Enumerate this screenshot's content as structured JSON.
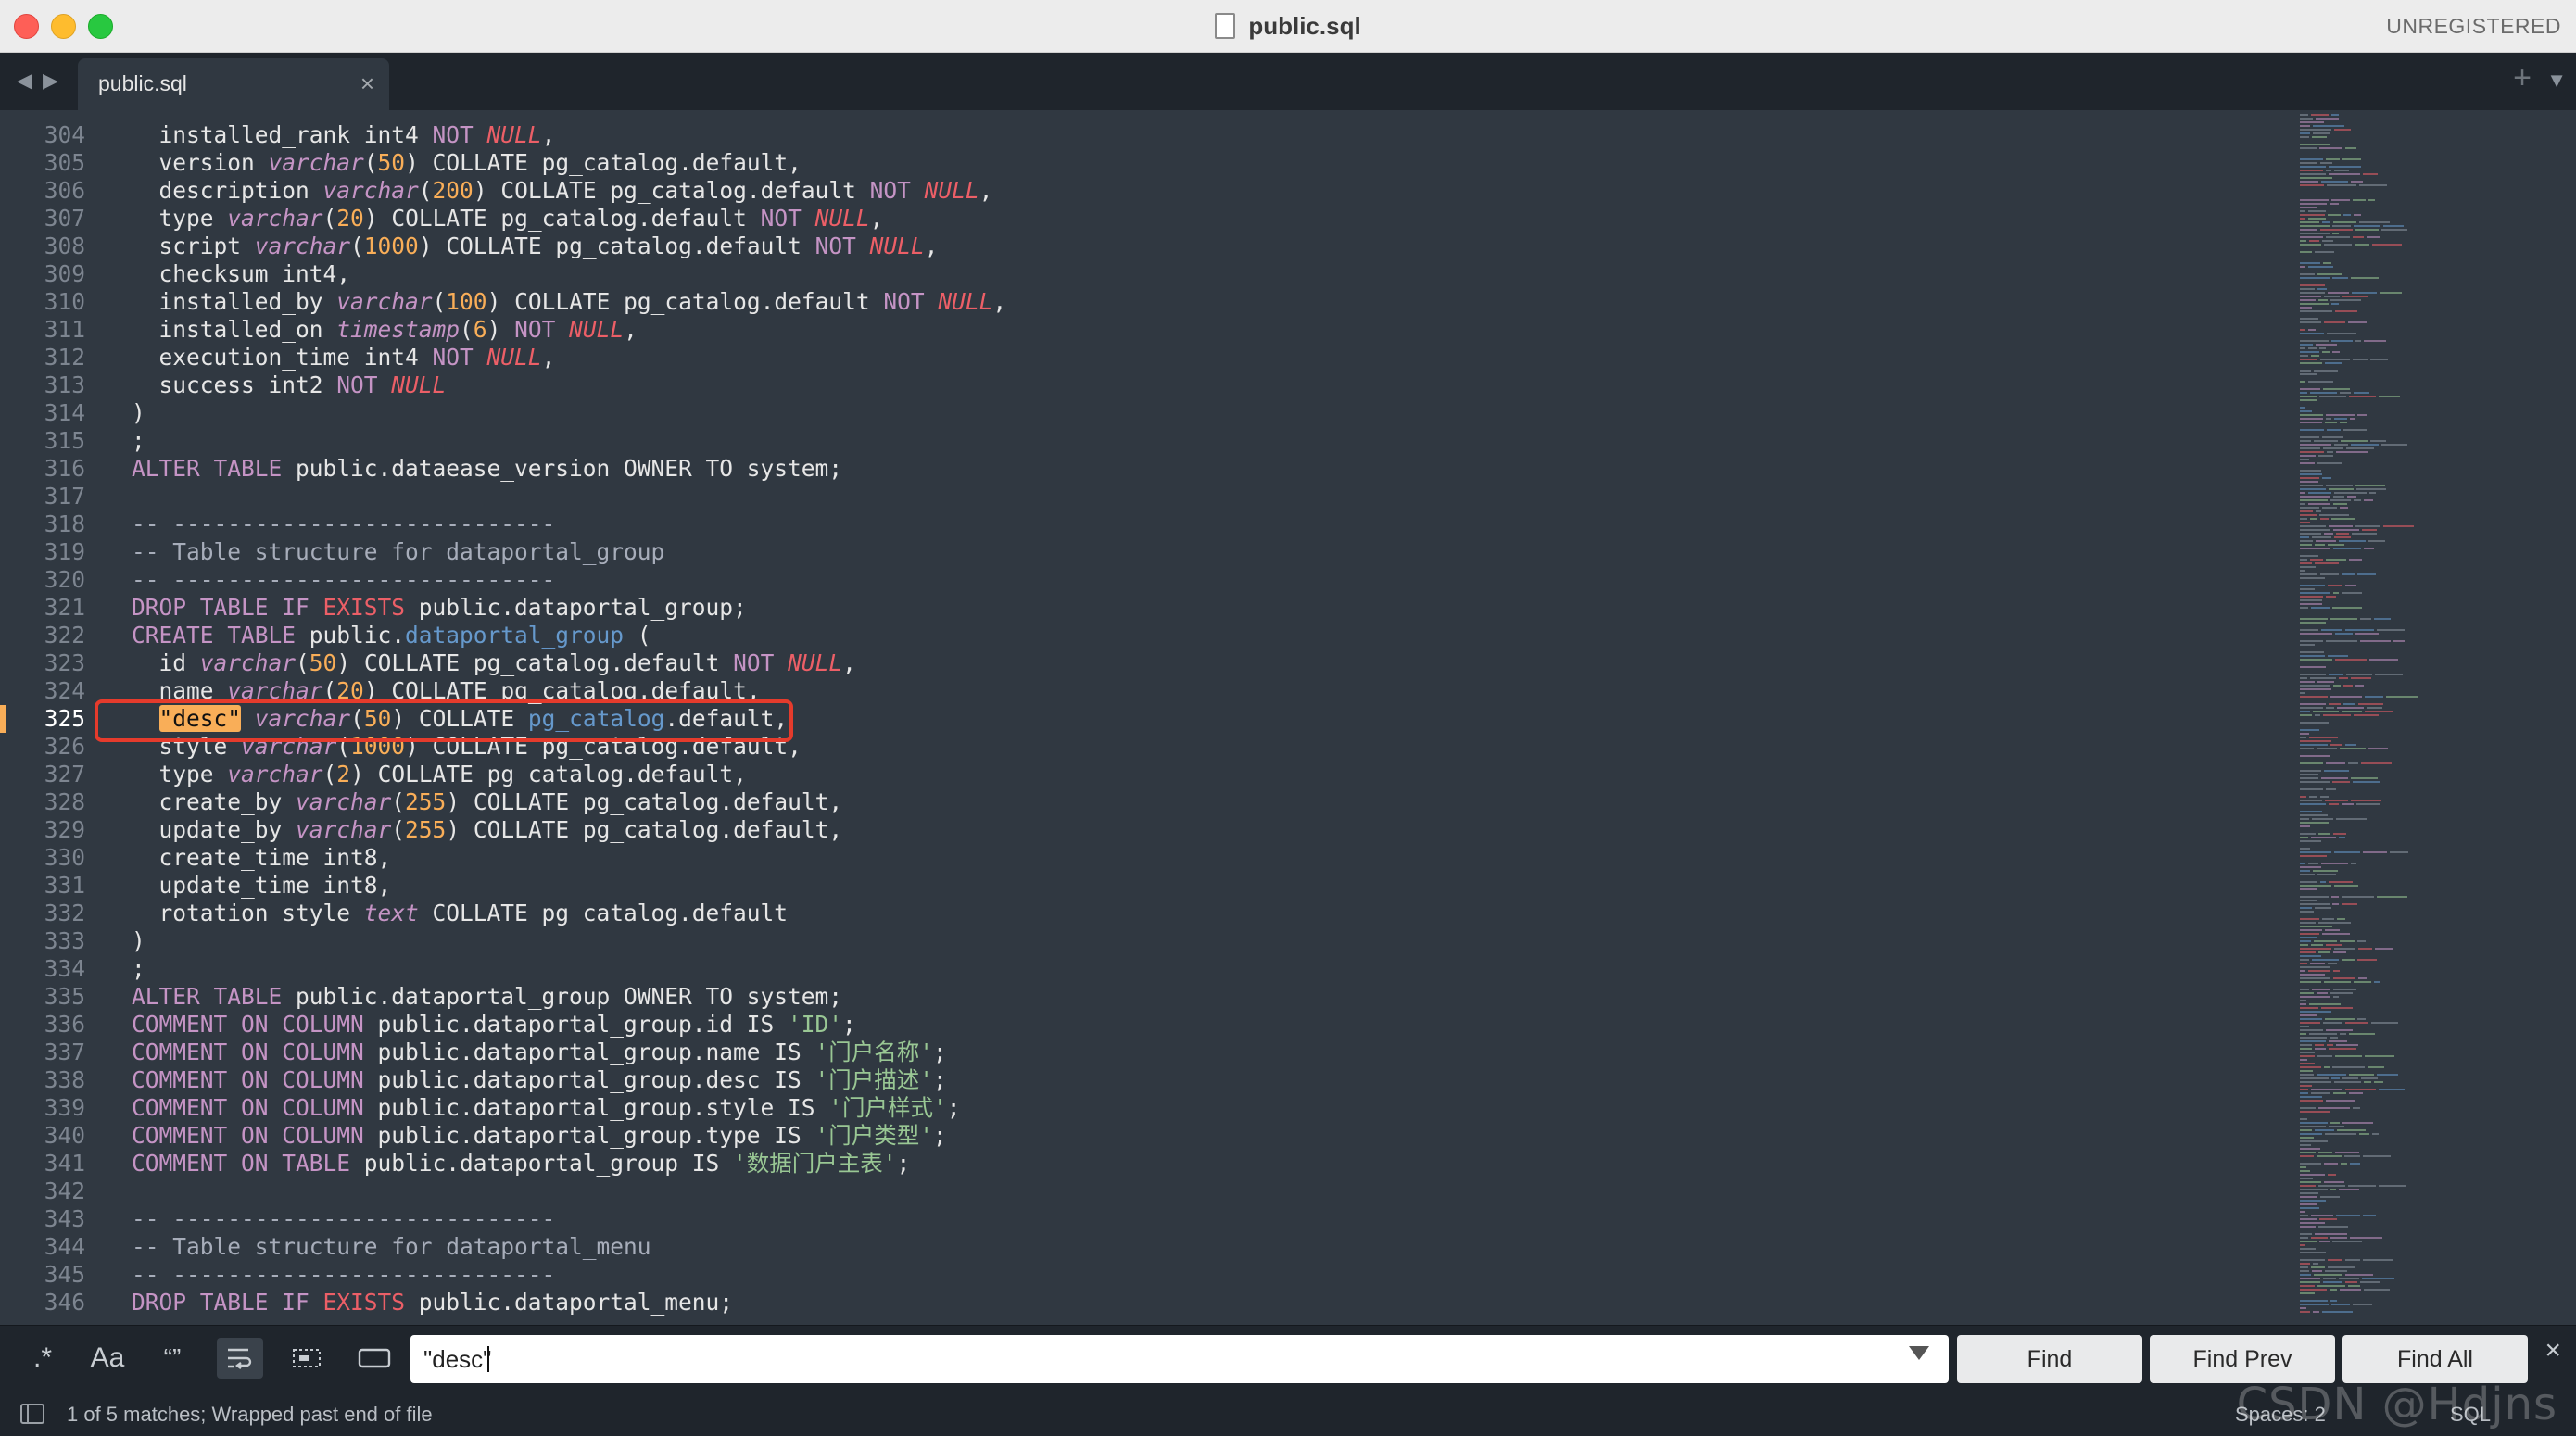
{
  "window": {
    "title": "public.sql",
    "registration": "UNREGISTERED"
  },
  "tabs": [
    {
      "label": "public.sql",
      "active": true
    }
  ],
  "editor": {
    "current_line": 325,
    "lines": [
      {
        "n": "304",
        "t": [
          [
            "  installed_rank int4 ",
            "plain"
          ],
          [
            "NOT",
            "kw"
          ],
          [
            " ",
            "plain"
          ],
          [
            "NULL",
            "redit"
          ],
          [
            ",",
            "plain"
          ]
        ]
      },
      {
        "n": "305",
        "t": [
          [
            "  version ",
            "plain"
          ],
          [
            "varchar",
            "type"
          ],
          [
            "(",
            "plain"
          ],
          [
            "50",
            "num"
          ],
          [
            ") COLLATE pg_catalog.default,",
            "plain"
          ]
        ]
      },
      {
        "n": "306",
        "t": [
          [
            "  description ",
            "plain"
          ],
          [
            "varchar",
            "type"
          ],
          [
            "(",
            "plain"
          ],
          [
            "200",
            "num"
          ],
          [
            ") COLLATE pg_catalog.default ",
            "plain"
          ],
          [
            "NOT",
            "kw"
          ],
          [
            " ",
            "plain"
          ],
          [
            "NULL",
            "redit"
          ],
          [
            ",",
            "plain"
          ]
        ]
      },
      {
        "n": "307",
        "t": [
          [
            "  type ",
            "plain"
          ],
          [
            "varchar",
            "type"
          ],
          [
            "(",
            "plain"
          ],
          [
            "20",
            "num"
          ],
          [
            ") COLLATE pg_catalog.default ",
            "plain"
          ],
          [
            "NOT",
            "kw"
          ],
          [
            " ",
            "plain"
          ],
          [
            "NULL",
            "redit"
          ],
          [
            ",",
            "plain"
          ]
        ]
      },
      {
        "n": "308",
        "t": [
          [
            "  script ",
            "plain"
          ],
          [
            "varchar",
            "type"
          ],
          [
            "(",
            "plain"
          ],
          [
            "1000",
            "num"
          ],
          [
            ") COLLATE pg_catalog.default ",
            "plain"
          ],
          [
            "NOT",
            "kw"
          ],
          [
            " ",
            "plain"
          ],
          [
            "NULL",
            "redit"
          ],
          [
            ",",
            "plain"
          ]
        ]
      },
      {
        "n": "309",
        "t": [
          [
            "  checksum int4,",
            "plain"
          ]
        ]
      },
      {
        "n": "310",
        "t": [
          [
            "  installed_by ",
            "plain"
          ],
          [
            "varchar",
            "type"
          ],
          [
            "(",
            "plain"
          ],
          [
            "100",
            "num"
          ],
          [
            ") COLLATE pg_catalog.default ",
            "plain"
          ],
          [
            "NOT",
            "kw"
          ],
          [
            " ",
            "plain"
          ],
          [
            "NULL",
            "redit"
          ],
          [
            ",",
            "plain"
          ]
        ]
      },
      {
        "n": "311",
        "t": [
          [
            "  installed_on ",
            "plain"
          ],
          [
            "timestamp",
            "type"
          ],
          [
            "(",
            "plain"
          ],
          [
            "6",
            "num"
          ],
          [
            ") ",
            "plain"
          ],
          [
            "NOT",
            "kw"
          ],
          [
            " ",
            "plain"
          ],
          [
            "NULL",
            "redit"
          ],
          [
            ",",
            "plain"
          ]
        ]
      },
      {
        "n": "312",
        "t": [
          [
            "  execution_time int4 ",
            "plain"
          ],
          [
            "NOT",
            "kw"
          ],
          [
            " ",
            "plain"
          ],
          [
            "NULL",
            "redit"
          ],
          [
            ",",
            "plain"
          ]
        ]
      },
      {
        "n": "313",
        "t": [
          [
            "  success int2 ",
            "plain"
          ],
          [
            "NOT",
            "kw"
          ],
          [
            " ",
            "plain"
          ],
          [
            "NULL",
            "redit"
          ]
        ]
      },
      {
        "n": "314",
        "t": [
          [
            ")",
            "plain"
          ]
        ]
      },
      {
        "n": "315",
        "t": [
          [
            ";",
            "plain"
          ]
        ]
      },
      {
        "n": "316",
        "t": [
          [
            "ALTER TABLE",
            "kw"
          ],
          [
            " public.dataease_version OWNER TO system;",
            "plain"
          ]
        ]
      },
      {
        "n": "317",
        "t": []
      },
      {
        "n": "318",
        "t": [
          [
            "-- ----------------------------",
            "comment"
          ]
        ]
      },
      {
        "n": "319",
        "t": [
          [
            "-- Table structure for dataportal_group",
            "comment"
          ]
        ]
      },
      {
        "n": "320",
        "t": [
          [
            "-- ----------------------------",
            "comment"
          ]
        ]
      },
      {
        "n": "321",
        "t": [
          [
            "DROP TABLE IF ",
            "kw"
          ],
          [
            "EXISTS",
            "red"
          ],
          [
            " public.dataportal_group;",
            "plain"
          ]
        ]
      },
      {
        "n": "322",
        "t": [
          [
            "CREATE TABLE",
            "kw"
          ],
          [
            " public.",
            "plain"
          ],
          [
            "dataportal_group",
            "func"
          ],
          [
            " (",
            "plain"
          ]
        ]
      },
      {
        "n": "323",
        "t": [
          [
            "  id ",
            "plain"
          ],
          [
            "varchar",
            "type"
          ],
          [
            "(",
            "plain"
          ],
          [
            "50",
            "num"
          ],
          [
            ") COLLATE pg_catalog.default ",
            "plain"
          ],
          [
            "NOT",
            "kw"
          ],
          [
            " ",
            "plain"
          ],
          [
            "NULL",
            "redit"
          ],
          [
            ",",
            "plain"
          ]
        ]
      },
      {
        "n": "324",
        "t": [
          [
            "  name ",
            "plain"
          ],
          [
            "varchar",
            "type"
          ],
          [
            "(",
            "plain"
          ],
          [
            "20",
            "num"
          ],
          [
            ") COLLATE pg_catalog.default,",
            "plain"
          ]
        ]
      },
      {
        "n": "325",
        "t": [
          [
            "  ",
            "plain"
          ],
          [
            "\"desc\"",
            "hl"
          ],
          [
            " ",
            "plain"
          ],
          [
            "varchar",
            "type"
          ],
          [
            "(",
            "plain"
          ],
          [
            "50",
            "num"
          ],
          [
            ") COLLATE ",
            "plain"
          ],
          [
            "pg_catalog",
            "func"
          ],
          [
            ".default,",
            "plain"
          ]
        ]
      },
      {
        "n": "326",
        "t": [
          [
            "  style ",
            "plain"
          ],
          [
            "varchar",
            "type"
          ],
          [
            "(",
            "plain"
          ],
          [
            "1000",
            "num"
          ],
          [
            ") COLLATE pg_catalog.default,",
            "plain"
          ]
        ]
      },
      {
        "n": "327",
        "t": [
          [
            "  type ",
            "plain"
          ],
          [
            "varchar",
            "type"
          ],
          [
            "(",
            "plain"
          ],
          [
            "2",
            "num"
          ],
          [
            ") COLLATE pg_catalog.default,",
            "plain"
          ]
        ]
      },
      {
        "n": "328",
        "t": [
          [
            "  create_by ",
            "plain"
          ],
          [
            "varchar",
            "type"
          ],
          [
            "(",
            "plain"
          ],
          [
            "255",
            "num"
          ],
          [
            ") COLLATE pg_catalog.default,",
            "plain"
          ]
        ]
      },
      {
        "n": "329",
        "t": [
          [
            "  update_by ",
            "plain"
          ],
          [
            "varchar",
            "type"
          ],
          [
            "(",
            "plain"
          ],
          [
            "255",
            "num"
          ],
          [
            ") COLLATE pg_catalog.default,",
            "plain"
          ]
        ]
      },
      {
        "n": "330",
        "t": [
          [
            "  create_time int8,",
            "plain"
          ]
        ]
      },
      {
        "n": "331",
        "t": [
          [
            "  update_time int8,",
            "plain"
          ]
        ]
      },
      {
        "n": "332",
        "t": [
          [
            "  rotation_style ",
            "plain"
          ],
          [
            "text",
            "type"
          ],
          [
            " COLLATE pg_catalog.default",
            "plain"
          ]
        ]
      },
      {
        "n": "333",
        "t": [
          [
            ")",
            "plain"
          ]
        ]
      },
      {
        "n": "334",
        "t": [
          [
            ";",
            "plain"
          ]
        ]
      },
      {
        "n": "335",
        "t": [
          [
            "ALTER TABLE",
            "kw"
          ],
          [
            " public.dataportal_group OWNER TO system;",
            "plain"
          ]
        ]
      },
      {
        "n": "336",
        "t": [
          [
            "COMMENT ON COLUMN",
            "kw"
          ],
          [
            " public.dataportal_group.id IS ",
            "plain"
          ],
          [
            "'ID'",
            "str"
          ],
          [
            ";",
            "plain"
          ]
        ]
      },
      {
        "n": "337",
        "t": [
          [
            "COMMENT ON COLUMN",
            "kw"
          ],
          [
            " public.dataportal_group.name IS ",
            "plain"
          ],
          [
            "'门户名称'",
            "str"
          ],
          [
            ";",
            "plain"
          ]
        ]
      },
      {
        "n": "338",
        "t": [
          [
            "COMMENT ON COLUMN",
            "kw"
          ],
          [
            " public.dataportal_group.desc IS ",
            "plain"
          ],
          [
            "'门户描述'",
            "str"
          ],
          [
            ";",
            "plain"
          ]
        ]
      },
      {
        "n": "339",
        "t": [
          [
            "COMMENT ON COLUMN",
            "kw"
          ],
          [
            " public.dataportal_group.style IS ",
            "plain"
          ],
          [
            "'门户样式'",
            "str"
          ],
          [
            ";",
            "plain"
          ]
        ]
      },
      {
        "n": "340",
        "t": [
          [
            "COMMENT ON COLUMN",
            "kw"
          ],
          [
            " public.dataportal_group.type IS ",
            "plain"
          ],
          [
            "'门户类型'",
            "str"
          ],
          [
            ";",
            "plain"
          ]
        ]
      },
      {
        "n": "341",
        "t": [
          [
            "COMMENT ON TABLE",
            "kw"
          ],
          [
            " public.dataportal_group IS ",
            "plain"
          ],
          [
            "'数据门户主表'",
            "str"
          ],
          [
            ";",
            "plain"
          ]
        ]
      },
      {
        "n": "342",
        "t": []
      },
      {
        "n": "343",
        "t": [
          [
            "-- ----------------------------",
            "comment"
          ]
        ]
      },
      {
        "n": "344",
        "t": [
          [
            "-- Table structure for dataportal_menu",
            "comment"
          ]
        ]
      },
      {
        "n": "345",
        "t": [
          [
            "-- ----------------------------",
            "comment"
          ]
        ]
      },
      {
        "n": "346",
        "t": [
          [
            "DROP TABLE IF ",
            "kw"
          ],
          [
            "EXISTS",
            "red"
          ],
          [
            " public.dataportal_menu;",
            "plain"
          ]
        ]
      }
    ]
  },
  "find": {
    "options": {
      "regex": ".*",
      "case": "Aa",
      "whole_word": "“”"
    },
    "query": "\"desc\"",
    "buttons": {
      "find": "Find",
      "find_prev": "Find Prev",
      "find_all": "Find All"
    }
  },
  "status": {
    "matches": "1 of 5 matches; Wrapped past end of file",
    "indent": "Spaces: 2",
    "syntax": "SQL",
    "watermark": "CSDN @Hdjns"
  },
  "colors": {
    "background": "#303841",
    "panel": "#1f252c",
    "keyword": "#c594c5",
    "string": "#99c794",
    "number": "#f9ae58",
    "null": "#ec5f67",
    "highlight": "#f9ae58",
    "annotation_box": "#e53b2c"
  },
  "icons": {
    "close": "close-icon",
    "tab_left": "chevron-left-icon",
    "tab_right": "chevron-right-icon",
    "new_tab": "plus-icon",
    "tab_menu": "chevron-down-icon",
    "file": "file-icon"
  }
}
